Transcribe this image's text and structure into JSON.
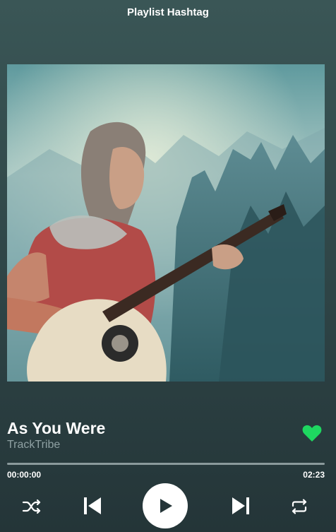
{
  "header": {
    "title": "Playlist Hashtag"
  },
  "track": {
    "title": "As You Were",
    "artist": "TrackTribe",
    "liked": true
  },
  "progress": {
    "elapsed": "00:00:00",
    "total": "02:23",
    "fraction": 0
  },
  "controls": {
    "shuffle_icon": "shuffle-icon",
    "prev_icon": "skip-previous-icon",
    "play_icon": "play-icon",
    "next_icon": "skip-next-icon",
    "repeat_icon": "repeat-icon"
  },
  "colors": {
    "background": "#2e4446",
    "accent_heart": "#1ed760",
    "muted_text": "#8fa1a3"
  }
}
